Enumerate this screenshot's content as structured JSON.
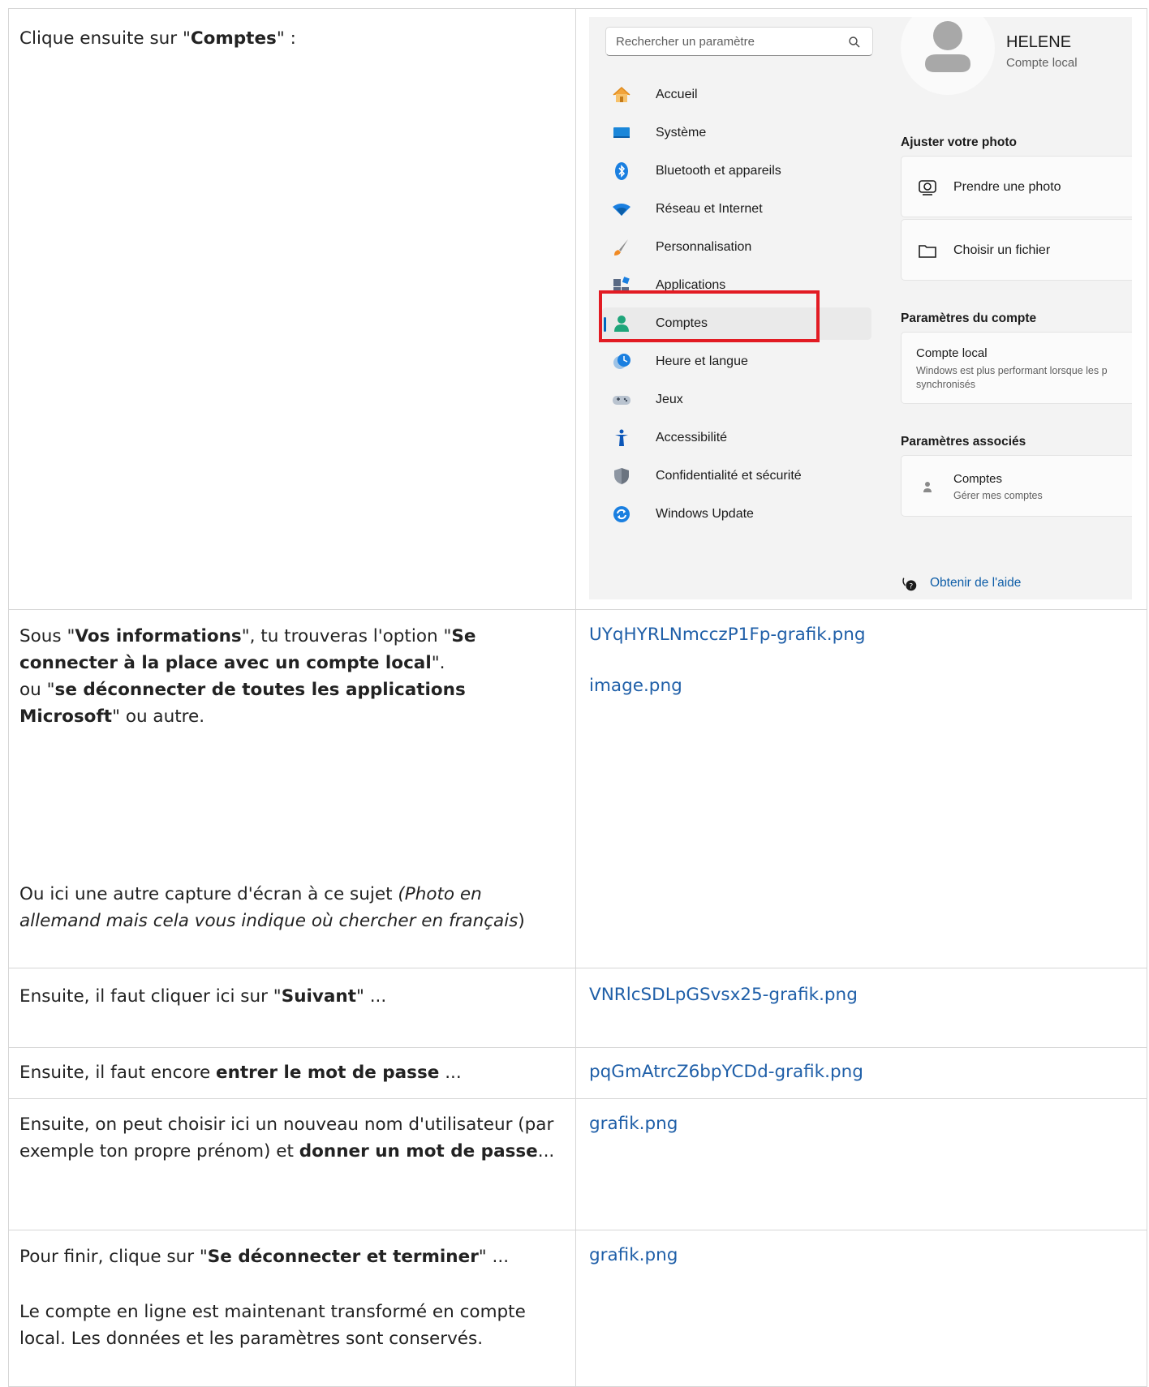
{
  "rows": [
    {
      "left_html": "Clique ensuite sur \"<b>Comptes</b>\" :"
    },
    {
      "left_html": "Sous \"<b>Vos informations</b>\", tu trouveras l'option \"<b>Se connecter à la place avec un compte local</b>\".<br>ou \"<b>se déconnecter de toutes les applications Microsoft</b>\" ou autre.",
      "left_html_2": "Ou ici une autre capture d'écran à ce sujet <i>(Photo en allemand mais cela vous indique où chercher en français</i>)",
      "links": [
        "UYqHYRLNmcczP1Fp-grafik.png",
        "image.png"
      ]
    },
    {
      "left_html": "Ensuite, il faut cliquer ici sur \"<b>Suivant</b>\" ...",
      "links": [
        "VNRlcSDLpGSvsx25-grafik.png"
      ]
    },
    {
      "left_html": "Ensuite, il faut encore <b>entrer le mot de passe</b> ...",
      "links": [
        "pqGmAtrcZ6bpYCDd-grafik.png"
      ]
    },
    {
      "left_html": "Ensuite, on peut choisir ici un nouveau nom d'utilisateur (par exemple ton propre prénom) et <b>donner un mot de passe</b>...",
      "links": [
        "grafik.png"
      ]
    },
    {
      "left_html": "Pour finir, clique sur \"<b>Se déconnecter et terminer</b>\" ...",
      "left_html_2": "Le compte en ligne est maintenant transformé en compte local. Les données et les paramètres sont conservés.",
      "links": [
        "grafik.png"
      ]
    }
  ],
  "settings": {
    "search_placeholder": "Rechercher un paramètre",
    "nav": [
      {
        "label": "Accueil",
        "icon": "home-icon"
      },
      {
        "label": "Système",
        "icon": "system-icon"
      },
      {
        "label": "Bluetooth et appareils",
        "icon": "bluetooth-icon"
      },
      {
        "label": "Réseau et Internet",
        "icon": "wifi-icon"
      },
      {
        "label": "Personnalisation",
        "icon": "brush-icon"
      },
      {
        "label": "Applications",
        "icon": "apps-icon"
      },
      {
        "label": "Comptes",
        "icon": "accounts-icon",
        "selected": true
      },
      {
        "label": "Heure et langue",
        "icon": "clock-globe-icon"
      },
      {
        "label": "Jeux",
        "icon": "gamepad-icon"
      },
      {
        "label": "Accessibilité",
        "icon": "accessibility-icon"
      },
      {
        "label": "Confidentialité et sécurité",
        "icon": "shield-icon"
      },
      {
        "label": "Windows Update",
        "icon": "update-icon"
      }
    ],
    "user_name": "HELENE",
    "user_type": "Compte local",
    "photo_section": "Ajuster votre photo",
    "take_photo": "Prendre une photo",
    "choose_file": "Choisir un fichier",
    "account_section": "Paramètres du compte",
    "local_account_title": "Compte local",
    "local_account_desc_1": "Windows est plus performant lorsque les p",
    "local_account_desc_2": "synchronisés",
    "related_section": "Paramètres associés",
    "related_title": "Comptes",
    "related_desc": "Gérer mes comptes",
    "help_link": "Obtenir de l'aide",
    "accent_color": "#0067c0",
    "highlight_color": "#e21b23"
  }
}
